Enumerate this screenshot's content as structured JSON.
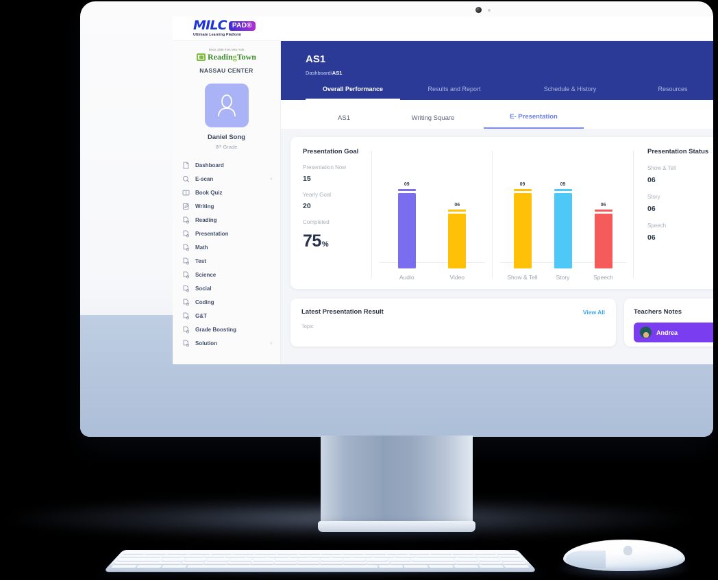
{
  "app": {
    "logo_main": "MILC",
    "logo_badge": "PAD®",
    "logo_tagline": "Ultimate Learning Platform"
  },
  "sidebar": {
    "org_since": "Since 1986 from New York",
    "org_name_1": "Readin",
    "org_name_g": "g",
    "org_name_2": "Town",
    "center": "NASSAU CENTER",
    "student_name": "Daniel Song",
    "student_grade": "8ᵗʰ Grade",
    "items": [
      {
        "label": "Dashboard",
        "icon": "document-icon",
        "chevron": ""
      },
      {
        "label": "E-scan",
        "icon": "magnifier-icon",
        "chevron": "‹"
      },
      {
        "label": "Book Quiz",
        "icon": "book-icon",
        "chevron": ""
      },
      {
        "label": "Writing",
        "icon": "pen-document-icon",
        "chevron": ""
      },
      {
        "label": "Reading",
        "icon": "file-badge-icon",
        "chevron": ""
      },
      {
        "label": "Presentation",
        "icon": "file-badge-icon",
        "chevron": ""
      },
      {
        "label": "Math",
        "icon": "file-badge-icon",
        "chevron": ""
      },
      {
        "label": "Test",
        "icon": "file-badge-icon",
        "chevron": ""
      },
      {
        "label": "Science",
        "icon": "file-badge-icon",
        "chevron": ""
      },
      {
        "label": "Social",
        "icon": "file-badge-icon",
        "chevron": ""
      },
      {
        "label": "Coding",
        "icon": "file-badge-icon",
        "chevron": ""
      },
      {
        "label": "G&T",
        "icon": "file-badge-icon",
        "chevron": ""
      },
      {
        "label": "Grade Boosting",
        "icon": "file-badge-icon",
        "chevron": ""
      },
      {
        "label": "Solution",
        "icon": "file-badge-icon",
        "chevron": "‹"
      }
    ]
  },
  "hero": {
    "title": "AS1",
    "breadcrumb_prefix": "Dashboard/",
    "breadcrumb_current": "AS1",
    "tabs": [
      {
        "label": "Overall Performance",
        "active": true
      },
      {
        "label": "Results and Report",
        "active": false
      },
      {
        "label": "Schedule & History",
        "active": false
      },
      {
        "label": "Resources",
        "active": false
      }
    ]
  },
  "subtabs": [
    {
      "label": "AS1",
      "active": false
    },
    {
      "label": "Writing Square",
      "active": false
    },
    {
      "label": "E- Presentation",
      "active": true
    }
  ],
  "goal_panel": {
    "title": "Presentation Goal",
    "now_label": "Presentation Now",
    "now_value": "15",
    "yearly_label": "Yearly Goal",
    "yearly_value": "20",
    "completed_label": "Completed",
    "completed_value": "75",
    "completed_unit": "%"
  },
  "status_panel": {
    "title": "Presentation Status",
    "rows": [
      {
        "label": "Show & Tell",
        "value": "06"
      },
      {
        "label": "Story",
        "value": "06"
      },
      {
        "label": "Speech",
        "value": "06"
      }
    ]
  },
  "result_card": {
    "title": "Latest Presentation Result",
    "view_all": "View All",
    "column_topic": "Topic"
  },
  "notes_card": {
    "title": "Teachers Notes",
    "note_name": "Andrea"
  },
  "chart_data": {
    "type": "bar",
    "title": "Presentation Goal",
    "groups": [
      {
        "name": "group-1",
        "categories": [
          "Audio",
          "Video"
        ],
        "values": [
          9,
          6
        ],
        "labels": [
          "09",
          "06"
        ],
        "colors": [
          "#7b6df0",
          "#ffc107"
        ]
      },
      {
        "name": "group-2",
        "categories": [
          "Show & Tell",
          "Story",
          "Speech"
        ],
        "values": [
          9,
          9,
          6
        ],
        "labels": [
          "09",
          "09",
          "06"
        ],
        "colors": [
          "#ffc107",
          "#4dc8f7",
          "#f65b5b"
        ]
      }
    ],
    "ylim": [
      0,
      10
    ],
    "xlabel": "",
    "ylabel": "",
    "grid": false,
    "legend": "none"
  },
  "colors": {
    "hero_blue": "#2c3a97",
    "accent_periwinkle": "#7a8bf0",
    "link_blue": "#3ea8f5",
    "bar_purple": "#7b6df0",
    "bar_yellow": "#ffc107",
    "bar_cyan": "#4dc8f7",
    "bar_red": "#f65b5b",
    "note_purple": "#7a3ef0"
  }
}
